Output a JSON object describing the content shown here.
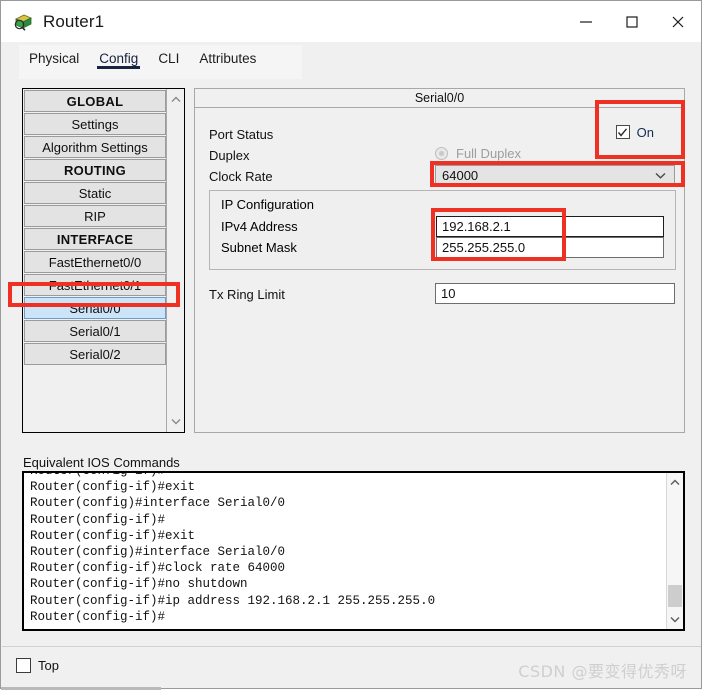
{
  "window": {
    "title": "Router1",
    "icon": "router-icon",
    "controls": {
      "minimize": "minimize-icon",
      "maximize": "maximize-icon",
      "close": "close-icon"
    }
  },
  "tabs": [
    {
      "label": "Physical",
      "active": false
    },
    {
      "label": "Config",
      "active": true
    },
    {
      "label": "CLI",
      "active": false
    },
    {
      "label": "Attributes",
      "active": false
    }
  ],
  "sidebar": {
    "items": [
      {
        "label": "GLOBAL",
        "type": "header"
      },
      {
        "label": "Settings",
        "type": "item"
      },
      {
        "label": "Algorithm Settings",
        "type": "item"
      },
      {
        "label": "ROUTING",
        "type": "header"
      },
      {
        "label": "Static",
        "type": "item"
      },
      {
        "label": "RIP",
        "type": "item"
      },
      {
        "label": "INTERFACE",
        "type": "header"
      },
      {
        "label": "FastEthernet0/0",
        "type": "item"
      },
      {
        "label": "FastEthernet0/1",
        "type": "item"
      },
      {
        "label": "Serial0/0",
        "type": "item",
        "selected": true
      },
      {
        "label": "Serial0/1",
        "type": "item"
      },
      {
        "label": "Serial0/2",
        "type": "item"
      }
    ],
    "scroll_up": "chevron-up-icon",
    "scroll_down": "chevron-down-icon"
  },
  "interface_panel": {
    "title": "Serial0/0",
    "port_status": {
      "label": "Port Status",
      "checkbox_label": "On",
      "checked": true
    },
    "duplex": {
      "label": "Duplex",
      "option_label": "Full Duplex",
      "disabled": true
    },
    "clock_rate": {
      "label": "Clock Rate",
      "value": "64000",
      "chevron": "chevron-down-icon"
    },
    "ip_configuration": {
      "title": "IP Configuration",
      "ipv4_label": "IPv4 Address",
      "ipv4_value": "192.168.2.1",
      "mask_label": "Subnet Mask",
      "mask_value": "255.255.255.0"
    },
    "tx_ring_limit": {
      "label": "Tx Ring Limit",
      "value": "10"
    }
  },
  "console": {
    "label": "Equivalent IOS Commands",
    "partial_top_line": "Router(config-if)#",
    "lines": [
      "Router(config-if)#exit",
      "Router(config)#interface Serial0/0",
      "Router(config-if)#",
      "Router(config-if)#exit",
      "Router(config)#interface Serial0/0",
      "Router(config-if)#clock rate 64000",
      "Router(config-if)#no shutdown",
      "Router(config-if)#ip address 192.168.2.1 255.255.255.0",
      "Router(config-if)#"
    ],
    "text": "Router(config-if)#\nRouter(config-if)#exit\nRouter(config)#interface Serial0/0\nRouter(config-if)#\nRouter(config-if)#exit\nRouter(config)#interface Serial0/0\nRouter(config-if)#clock rate 64000\nRouter(config-if)#no shutdown\nRouter(config-if)#ip address 192.168.2.1 255.255.255.0\nRouter(config-if)#",
    "scroll_up": "chevron-up-icon",
    "scroll_down": "chevron-down-icon"
  },
  "footer": {
    "top_checkbox_label": "Top",
    "top_checked": false,
    "watermark": "CSDN @要变得优秀呀"
  },
  "annotations": {
    "color": "#ef3124",
    "boxes": [
      "port-status-on",
      "clock-rate-select",
      "ip-fields",
      "sidebar-serial00"
    ]
  }
}
